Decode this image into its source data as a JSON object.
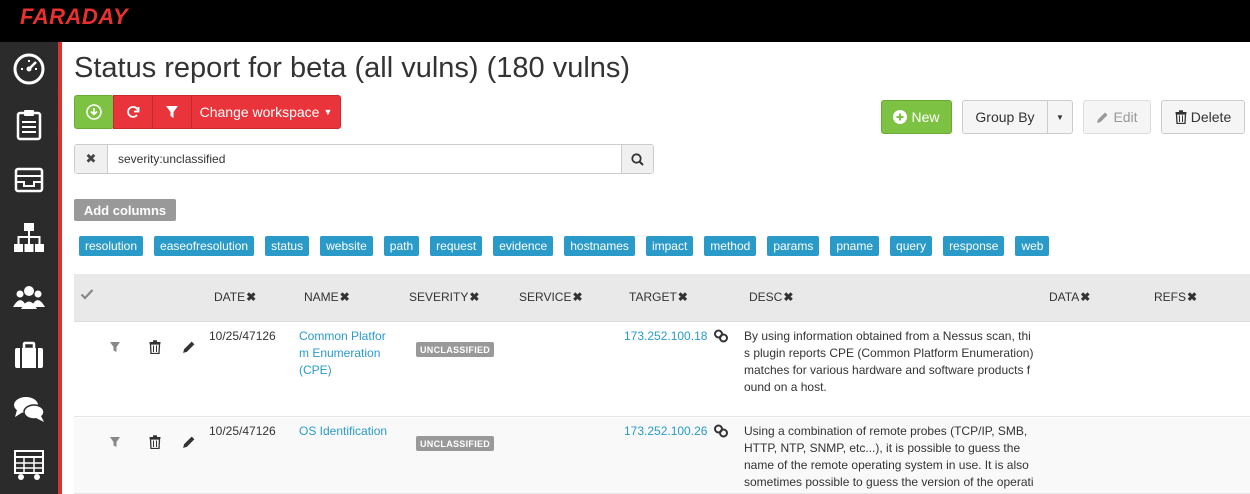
{
  "app": {
    "logo": "FARADAY"
  },
  "sidebar": {
    "items": [
      {
        "icon": "dashboard-gauge-icon"
      },
      {
        "icon": "clipboard-icon"
      },
      {
        "icon": "inbox-icon"
      },
      {
        "icon": "sitemap-icon"
      },
      {
        "icon": "users-icon"
      },
      {
        "icon": "briefcase-icon"
      },
      {
        "icon": "comments-icon"
      },
      {
        "icon": "table-cart-icon"
      }
    ],
    "accent_color": "#d9342b"
  },
  "page": {
    "title": "Status report for beta (all vulns) (180 vulns)"
  },
  "toolbar": {
    "change_workspace": "Change workspace",
    "new": "New",
    "group_by": "Group By",
    "edit": "Edit",
    "delete": "Delete"
  },
  "search": {
    "value": "severity:unclassified"
  },
  "columns_panel": {
    "add_columns": "Add columns",
    "tags": [
      "resolution",
      "easeofresolution",
      "status",
      "website",
      "path",
      "request",
      "evidence",
      "hostnames",
      "impact",
      "method",
      "params",
      "pname",
      "query",
      "response",
      "web"
    ]
  },
  "table": {
    "headers": [
      "DATE",
      "NAME",
      "SEVERITY",
      "SERVICE",
      "TARGET",
      "DESC",
      "DATA",
      "REFS"
    ],
    "rows": [
      {
        "date": "10/25/47126",
        "name": "Common Platform Enumeration (CPE)",
        "severity": "UNCLASSIFIED",
        "service": "",
        "target": "173.252.100.18",
        "desc": "By using information obtained from a Nessus scan, this plugin reports CPE (Common Platform Enumeration) matches for various hardware and software products found on a host."
      },
      {
        "date": "10/25/47126",
        "name": "OS Identification",
        "severity": "UNCLASSIFIED",
        "service": "",
        "target": "173.252.100.26",
        "desc": "Using a combination of remote probes (TCP/IP, SMB, HTTP, NTP, SNMP, etc...), it is possible to guess the name of the remote operating system in use. It is also sometimes possible to guess the version of the operati"
      }
    ]
  },
  "colors": {
    "brand_red": "#e8312f",
    "green": "#7dc242",
    "link_blue": "#2a9bc9",
    "tag_blue": "#2a9bc9"
  }
}
